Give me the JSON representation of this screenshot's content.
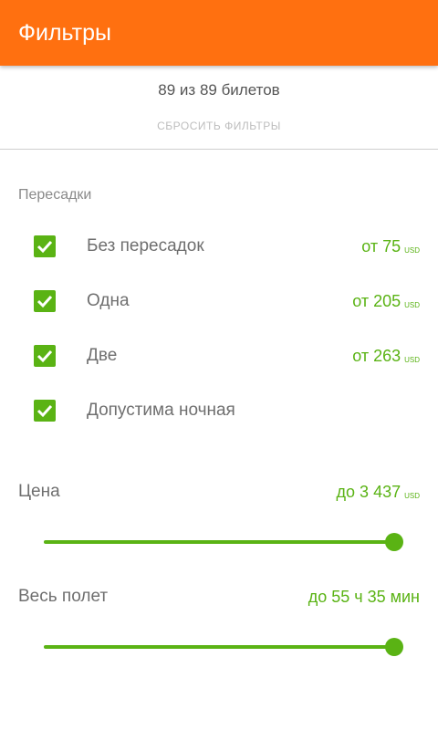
{
  "header": {
    "title": "Фильтры"
  },
  "summary": {
    "count_text": "89 из 89 билетов",
    "reset_label": "СБРОСИТЬ ФИЛЬТРЫ"
  },
  "stops": {
    "section_label": "Пересадки",
    "items": [
      {
        "label": "Без пересадок",
        "checked": true,
        "price": "от 75",
        "currency": "USD"
      },
      {
        "label": "Одна",
        "checked": true,
        "price": "от 205",
        "currency": "USD"
      },
      {
        "label": "Две",
        "checked": true,
        "price": "от 263",
        "currency": "USD"
      },
      {
        "label": "Допустима ночная",
        "checked": true
      }
    ]
  },
  "price_filter": {
    "label": "Цена",
    "value": "до 3 437",
    "currency": "USD",
    "slider_fraction": 1.0
  },
  "duration_filter": {
    "label": "Весь полет",
    "value": "до 55 ч 35 мин",
    "slider_fraction": 1.0
  },
  "colors": {
    "appbar": "#ff7010",
    "accent": "#5ab314",
    "divider": "#cfcfcf"
  }
}
